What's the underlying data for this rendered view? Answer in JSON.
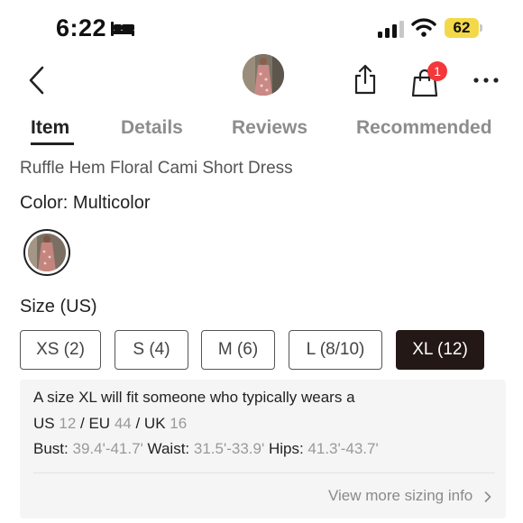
{
  "status_bar": {
    "time": "6:22",
    "battery": "62",
    "battery_color": "#f3d94a"
  },
  "nav": {
    "cart_count": "1",
    "badge_color": "#f2383a",
    "icons": [
      "chevron-left-icon",
      "share-icon",
      "shopping-bag-icon",
      "more-icon"
    ]
  },
  "tabs": [
    {
      "label": "Item",
      "active": true
    },
    {
      "label": "Details",
      "active": false
    },
    {
      "label": "Reviews",
      "active": false
    },
    {
      "label": "Recommended",
      "active": false
    }
  ],
  "product": {
    "title": "Ruffle Hem Floral Cami Short Dress",
    "color_label": "Color:",
    "color_value": "Multicolor"
  },
  "size": {
    "label": "Size (US)",
    "selected_color": "#231815",
    "options": [
      {
        "label": "XS (2)",
        "selected": false
      },
      {
        "label": "S (4)",
        "selected": false
      },
      {
        "label": "M (6)",
        "selected": false
      },
      {
        "label": "L (8/10)",
        "selected": false
      },
      {
        "label": "XL (12)",
        "selected": true
      }
    ]
  },
  "size_info": {
    "intro": "A size XL will fit someone who typically wears a",
    "us_label": "US",
    "us_value": "12",
    "eu_label": "/ EU",
    "eu_value": "44",
    "uk_label": "/ UK",
    "uk_value": "16",
    "bust_label": "Bust:",
    "bust_value": "39.4'-41.7'",
    "waist_label": "Waist:",
    "waist_value": "31.5'-33.9'",
    "hips_label": "Hips:",
    "hips_value": "41.3'-43.7'",
    "more_link": "View more sizing info"
  }
}
